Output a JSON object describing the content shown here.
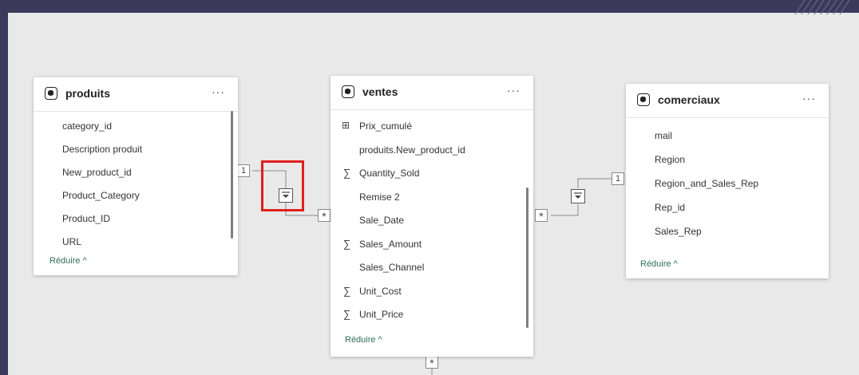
{
  "tables": [
    {
      "title": "produits",
      "more_label": "···",
      "fields": [
        {
          "name": "category_id",
          "icon": "none"
        },
        {
          "name": "Description produit",
          "icon": "none"
        },
        {
          "name": "New_product_id",
          "icon": "none"
        },
        {
          "name": "Product_Category",
          "icon": "none"
        },
        {
          "name": "Product_ID",
          "icon": "none"
        },
        {
          "name": "URL",
          "icon": "none"
        }
      ],
      "collapse_label": "Réduire ^"
    },
    {
      "title": "ventes",
      "more_label": "···",
      "fields": [
        {
          "name": "Prix_cumulé",
          "icon": "calc-measure"
        },
        {
          "name": "produits.New_product_id",
          "icon": "none"
        },
        {
          "name": "Quantity_Sold",
          "icon": "sigma"
        },
        {
          "name": "Remise 2",
          "icon": "none"
        },
        {
          "name": "Sale_Date",
          "icon": "none"
        },
        {
          "name": "Sales_Amount",
          "icon": "sigma"
        },
        {
          "name": "Sales_Channel",
          "icon": "none"
        },
        {
          "name": "Unit_Cost",
          "icon": "sigma"
        },
        {
          "name": "Unit_Price",
          "icon": "sigma"
        }
      ],
      "collapse_label": "Réduire ^"
    },
    {
      "title": "comerciaux",
      "more_label": "···",
      "fields": [
        {
          "name": "mail",
          "icon": "none"
        },
        {
          "name": "Region",
          "icon": "none"
        },
        {
          "name": "Region_and_Sales_Rep",
          "icon": "none"
        },
        {
          "name": "Rep_id",
          "icon": "none"
        },
        {
          "name": "Sales_Rep",
          "icon": "none"
        }
      ],
      "collapse_label": "Réduire ^"
    }
  ],
  "relationships": {
    "one_label": "1",
    "many_label": "*",
    "filter_direction_icon": "single-direction-filter-icon",
    "highlight_color": "#e0201b"
  },
  "colors": {
    "background": "#3b3a5a",
    "canvas": "#e9e9e9",
    "link_line": "#8a8a8a",
    "reduce_link": "#2f6e5a"
  },
  "icons": {
    "table": "table-icon",
    "sigma": "sigma-icon",
    "calc_measure": "calculated-measure-icon"
  }
}
